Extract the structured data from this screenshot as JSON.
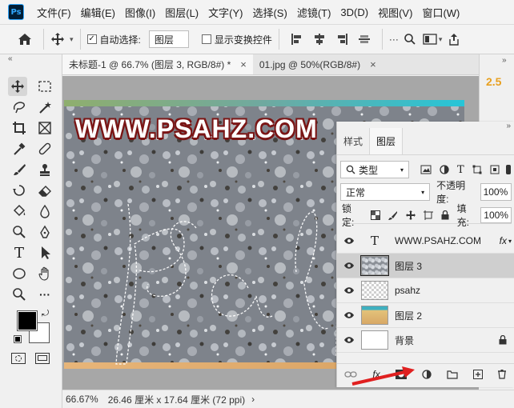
{
  "app": {
    "logo": "Ps"
  },
  "menu": [
    "文件(F)",
    "编辑(E)",
    "图像(I)",
    "图层(L)",
    "文字(Y)",
    "选择(S)",
    "滤镜(T)",
    "3D(D)",
    "视图(V)",
    "窗口(W)"
  ],
  "options": {
    "auto_select_label": "自动选择:",
    "auto_select_checked": "✓",
    "auto_select_value": "图层",
    "show_transform_label": "显示变换控件"
  },
  "tabs": [
    {
      "label": "未标题-1 @ 66.7% (图层 3, RGB/8#) *",
      "close": "×"
    },
    {
      "label": "01.jpg @ 50%(RGB/8#)",
      "close": "×"
    }
  ],
  "right_strip": {
    "value": "2.5"
  },
  "canvas": {
    "watermark": "WWW.PSAHZ.COM",
    "selection_text": "psah"
  },
  "status": {
    "zoom": "66.67%",
    "doc_info": "26.46 厘米 x 17.64 厘米 (72 ppi)",
    "arrow": "›"
  },
  "layers_panel": {
    "tabs": [
      "样式",
      "图层"
    ],
    "filter_label": "类型",
    "blend_mode": "正常",
    "opacity_label": "不透明度:",
    "opacity_value": "100%",
    "lock_label": "锁定:",
    "fill_label": "填充:",
    "fill_value": "100%",
    "layers": [
      {
        "name": "WWW.PSAHZ.COM",
        "type": "text",
        "fx": "fx"
      },
      {
        "name": "图层 3",
        "type": "image",
        "selected": true
      },
      {
        "name": "psahz",
        "type": "transparent"
      },
      {
        "name": "图层 2",
        "type": "image"
      },
      {
        "name": "背景",
        "type": "fill"
      }
    ],
    "bottom_fx": "fx"
  },
  "colors": {
    "accent": "#e8a020",
    "arrow_red": "#e02020"
  }
}
